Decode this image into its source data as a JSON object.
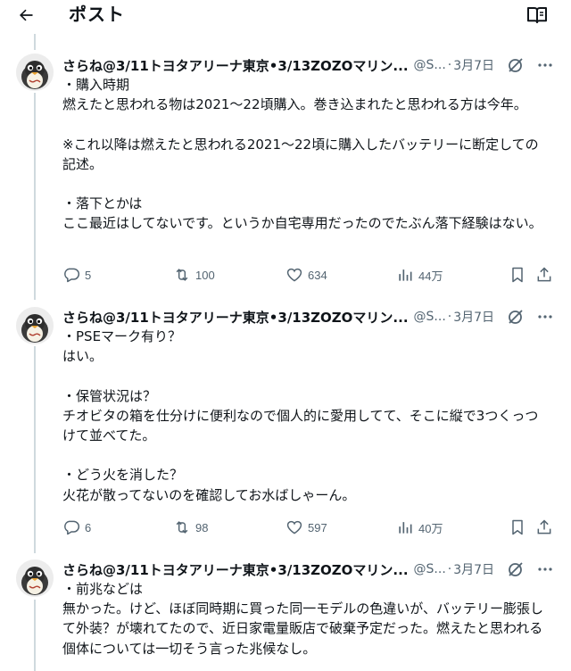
{
  "header": {
    "title": "ポスト"
  },
  "posts": [
    {
      "display_name": "さらね@3/11トヨタアリーナ東京•3/13ZOZOマリン...",
      "handle": "@S...",
      "dot": "·",
      "date": "3月7日",
      "body": "・購入時期\n燃えたと思われる物は2021〜22頃購入。巻き込まれたと思われる方は今年。\n\n※これ以降は燃えたと思われる2021〜22頃に購入したバッテリーに断定しての記述。\n\n・落下とかは\nここ最近はしてないです。というか自宅専用だったのでたぶん落下経験はない。",
      "replies": "5",
      "reposts": "100",
      "likes": "634",
      "views": "44万"
    },
    {
      "display_name": "さらね@3/11トヨタアリーナ東京•3/13ZOZOマリン...",
      "handle": "@S...",
      "dot": "·",
      "date": "3月7日",
      "body": "・PSEマーク有り？\nはい。\n\n・保管状況は？\nチオビタの箱を仕分けに便利なので個人的に愛用してて、そこに縦で3つくっつけて並べてた。\n\n・どう火を消した？\n火花が散ってないのを確認してお水ばしゃーん。",
      "replies": "6",
      "reposts": "98",
      "likes": "597",
      "views": "40万"
    },
    {
      "display_name": "さらね@3/11トヨタアリーナ東京•3/13ZOZOマリン...",
      "handle": "@S...",
      "dot": "·",
      "date": "3月7日",
      "body": "・前兆などは\n無かった。けど、ほぼ同時期に買った同一モデルの色違いが、バッテリー膨張して外装？が壊れてたので、近日家電量販店で破棄予定だった。燃えたと思われる個体については一切そう言った兆候なし。"
    }
  ],
  "colors": {
    "text": "#0f1419",
    "secondary": "#536471",
    "thread_line": "#cfd9de"
  }
}
